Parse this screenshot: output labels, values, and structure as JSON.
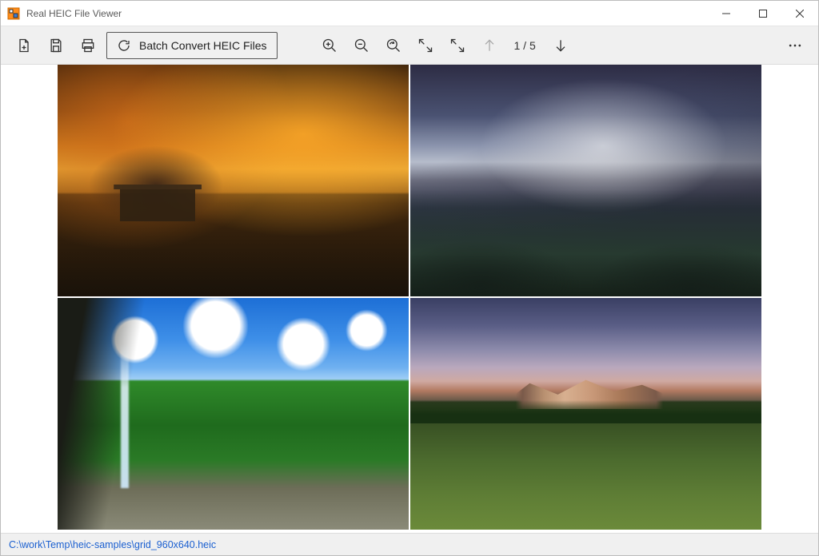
{
  "window": {
    "title": "Real HEIC File Viewer"
  },
  "toolbar": {
    "batch_label": "Batch Convert HEIC Files",
    "page_counter": "1 / 5"
  },
  "status": {
    "filepath": "C:\\work\\Temp\\heic-samples\\grid_960x640.heic"
  },
  "viewer": {
    "current_page": 1,
    "total_pages": 5,
    "grid": {
      "cols": 2,
      "rows": 2,
      "thumbnails": [
        {
          "name": "thumbnail-1",
          "description": "autumn forest pond with wooden gazebo"
        },
        {
          "name": "thumbnail-2",
          "description": "snowy mountain valley (Yosemite-like)"
        },
        {
          "name": "thumbnail-3",
          "description": "waterfall into green valley under blue sky"
        },
        {
          "name": "thumbnail-4",
          "description": "alpine meadow at sunset with distant peaks"
        }
      ]
    }
  },
  "icons": {
    "new": "new-file-icon",
    "save": "save-icon",
    "print": "print-icon",
    "refresh": "refresh-icon",
    "zoom_in": "zoom-in-icon",
    "zoom_out": "zoom-out-icon",
    "rotate": "rotate-icon",
    "fit": "fit-screen-icon",
    "actual": "actual-size-icon",
    "prev": "arrow-up-icon",
    "next": "arrow-down-icon",
    "more": "more-icon"
  }
}
